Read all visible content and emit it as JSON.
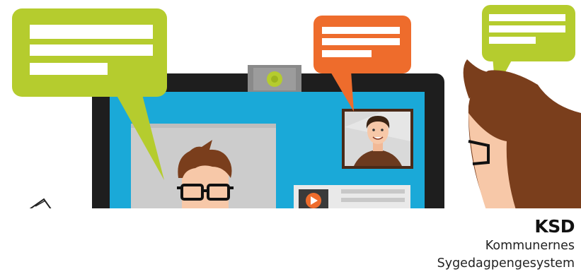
{
  "brand": {
    "logo_text": "KSD",
    "name_line_1": "Kommunernes",
    "name_line_2": "Sygedagpengesystem"
  },
  "colors": {
    "bubble_green": "#b5cc2e",
    "bubble_orange": "#ee6c2c",
    "screen_blue": "#1aa9d8",
    "monitor_dark": "#1e1e1e",
    "hair_brown": "#7a3e1c",
    "skin": "#f7c8a8"
  },
  "icons": {
    "webcam": "webcam-icon",
    "play": "play-icon"
  }
}
